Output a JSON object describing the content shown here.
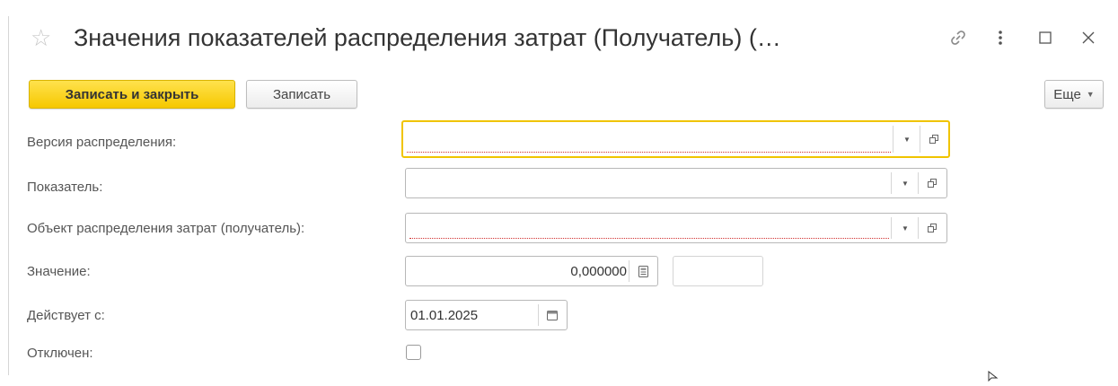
{
  "window": {
    "title": "Значения показателей распределения затрат (Получатель) (…"
  },
  "toolbar": {
    "save_close_label": "Записать и закрыть",
    "save_label": "Записать",
    "more_label": "Еще"
  },
  "form": {
    "distribution_version": {
      "label": "Версия распределения:",
      "value": ""
    },
    "indicator": {
      "label": "Показатель:",
      "value": ""
    },
    "cost_object": {
      "label": "Объект распределения затрат (получатель):",
      "value": ""
    },
    "value": {
      "label": "Значение:",
      "value": "0,000000"
    },
    "effective_from": {
      "label": "Действует с:",
      "value": "01.01.2025"
    },
    "disabled": {
      "label": "Отключен:",
      "checked": false
    }
  },
  "icons": {
    "star": "star-icon",
    "link": "link-icon",
    "menu": "more-vertical-icon",
    "maximize": "maximize-icon",
    "close": "close-icon"
  },
  "colors": {
    "primary_button": "#f6c800",
    "focus_border": "#f0c400",
    "required_underline": "#d03030"
  }
}
